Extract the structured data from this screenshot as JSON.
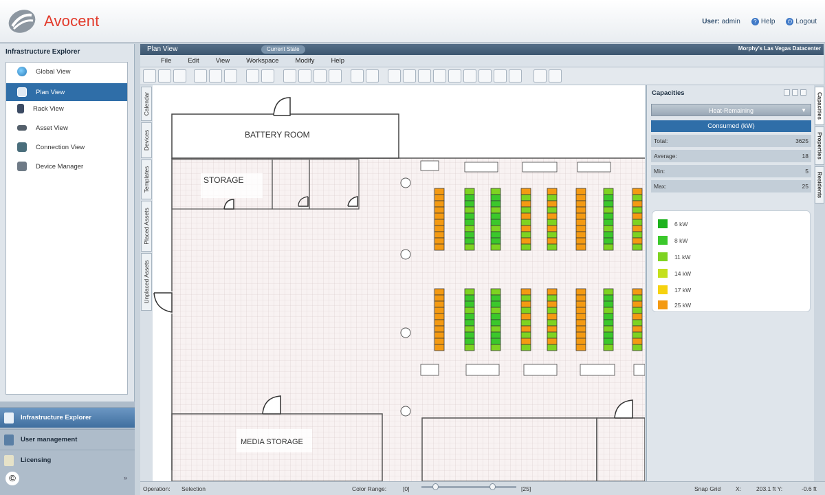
{
  "header": {
    "brand": "Avocent",
    "user_label": "User:",
    "user_name": "admin",
    "help": "Help",
    "logout": "Logout"
  },
  "explorer": {
    "title": "Infrastructure Explorer",
    "items": [
      {
        "label": "Global View",
        "icon": "globe-icon",
        "selected": false
      },
      {
        "label": "Plan View",
        "icon": "plan-icon",
        "selected": true
      },
      {
        "label": "Rack View",
        "icon": "rack-icon",
        "selected": false
      },
      {
        "label": "Asset View",
        "icon": "asset-icon",
        "selected": false
      },
      {
        "label": "Connection View",
        "icon": "connection-icon",
        "selected": false
      },
      {
        "label": "Device Manager",
        "icon": "device-manager-icon",
        "selected": false
      }
    ]
  },
  "sections": [
    {
      "label": "Infrastructure Explorer",
      "active": true
    },
    {
      "label": "User management",
      "active": false
    },
    {
      "label": "Licensing",
      "active": false
    }
  ],
  "plan_view": {
    "title": "Plan View",
    "badge": "Current State",
    "location": "Morphy's Las Vegas Datacenter",
    "menus": [
      "File",
      "Edit",
      "View",
      "Workspace",
      "Modify",
      "Help"
    ],
    "side_tabs": [
      "Calendar",
      "Devices",
      "Templates",
      "Placed Assets",
      "Unplaced Assets"
    ],
    "rooms": {
      "battery": "BATTERY ROOM",
      "storage": "STORAGE",
      "media": "MEDIA STORAGE"
    }
  },
  "capacities": {
    "title": "Capacities",
    "select": "Heat-Remaining",
    "mode": "Consumed (kW)",
    "stats": [
      {
        "label": "Total:",
        "value": "3625"
      },
      {
        "label": "Average:",
        "value": "18"
      },
      {
        "label": "Min:",
        "value": "5"
      },
      {
        "label": "Max:",
        "value": "25"
      }
    ],
    "legend": [
      {
        "label": "6 kW",
        "color": "#1db21d"
      },
      {
        "label": "8 kW",
        "color": "#3bc82b"
      },
      {
        "label": "11 kW",
        "color": "#7ed321"
      },
      {
        "label": "14 kW",
        "color": "#c4e01c"
      },
      {
        "label": "17 kW",
        "color": "#f6d20f"
      },
      {
        "label": "25 kW",
        "color": "#f49a12"
      }
    ],
    "right_tabs": [
      "Capacities",
      "Properties",
      "Residents"
    ]
  },
  "status": {
    "operation_label": "Operation:",
    "operation_value": "Selection",
    "color_range_label": "Color Range:",
    "range_min": "[0]",
    "range_max": "[25]",
    "snap_grid": "Snap Grid",
    "x_label": "X:",
    "x_value": "203.1 ft Y:",
    "y_value": "-0.6 ft"
  },
  "copyright": "©"
}
